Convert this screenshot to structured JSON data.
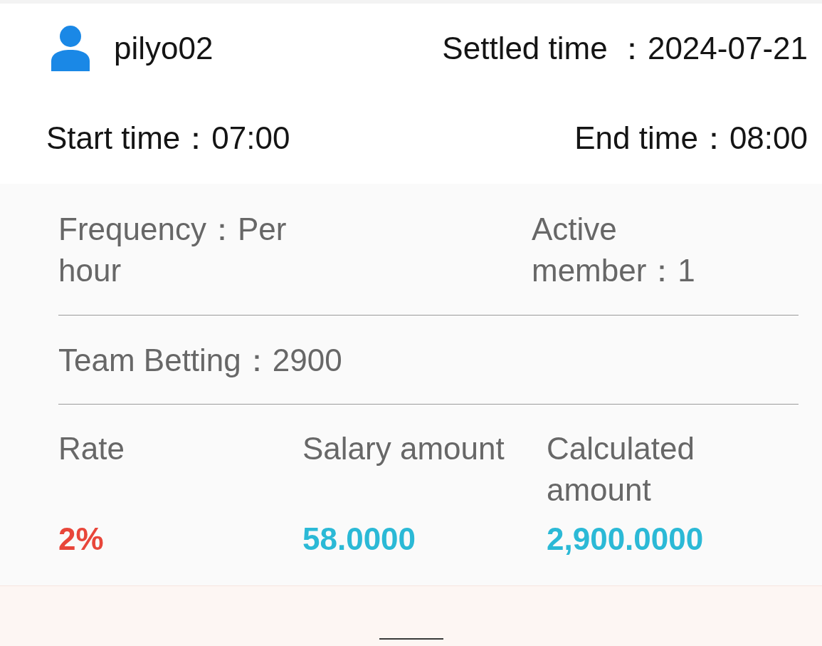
{
  "user": {
    "name": "pilyo02"
  },
  "settled_time": "Settled time ：2024-07-21",
  "start_time": "Start time：07:00",
  "end_time": "End time：08:00",
  "frequency": "Frequency：Per hour",
  "active_member": "Active member：1",
  "team_betting": "Team Betting：2900",
  "columns": [
    {
      "header": "Rate",
      "value": "2%",
      "kind": "rate"
    },
    {
      "header": "Salary amount",
      "value": "58.0000",
      "kind": "amount"
    },
    {
      "header": "Calculated amount",
      "value": "2,900.0000",
      "kind": "amount"
    }
  ]
}
